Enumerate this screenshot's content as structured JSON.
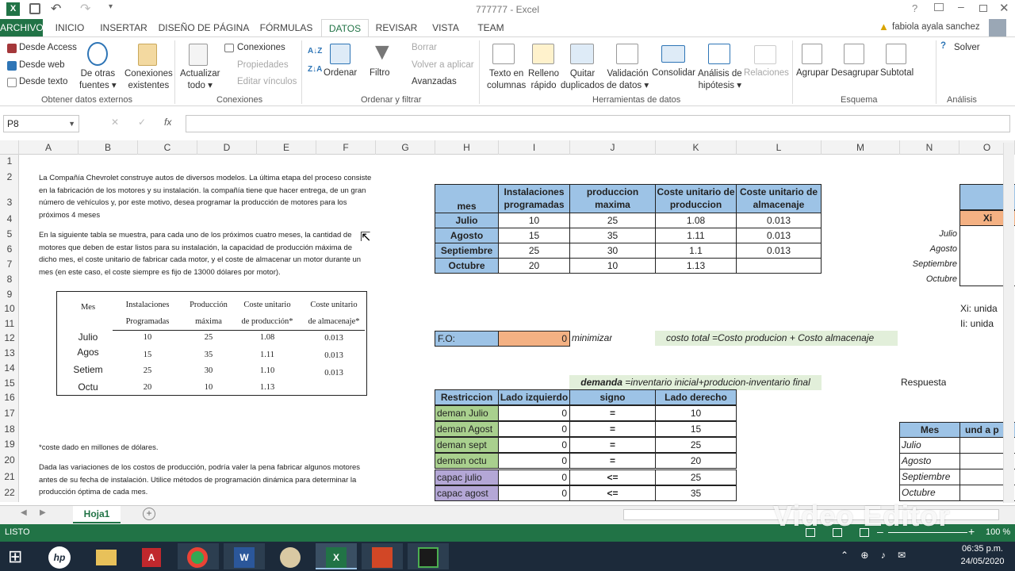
{
  "window": {
    "title": "777777 - Excel",
    "user": "fabiola ayala sanchez"
  },
  "ribbon_tabs": [
    "ARCHIVO",
    "INICIO",
    "INSERTAR",
    "DISEÑO DE PÁGINA",
    "FÓRMULAS",
    "DATOS",
    "REVISAR",
    "VISTA",
    "TEAM"
  ],
  "active_tab": "DATOS",
  "ribbon": {
    "access": "Desde Access",
    "web": "Desde web",
    "text": "Desde texto",
    "other_sources_1": "De otras",
    "other_sources_2": "fuentes",
    "existing_1": "Conexiones",
    "existing_2": "existentes",
    "refresh_1": "Actualizar",
    "refresh_2": "todo",
    "connections": "Conexiones",
    "properties": "Propiedades",
    "edit_links": "Editar vínculos",
    "sort": "Ordenar",
    "filter": "Filtro",
    "clear": "Borrar",
    "reapply": "Volver a aplicar",
    "advanced": "Avanzadas",
    "text_cols_1": "Texto en",
    "text_cols_2": "columnas",
    "flash_1": "Relleno",
    "flash_2": "rápido",
    "remove_dup_1": "Quitar",
    "remove_dup_2": "duplicados",
    "validation_1": "Validación",
    "validation_2": "de datos",
    "consolidate": "Consolidar",
    "whatif_1": "Análisis de",
    "whatif_2": "hipótesis",
    "relations": "Relaciones",
    "group": "Agrupar",
    "ungroup": "Desagrupar",
    "subtotal": "Subtotal",
    "solver": "Solver",
    "groups": {
      "external": "Obtener datos externos",
      "connections": "Conexiones",
      "sortfilter": "Ordenar y filtrar",
      "tools": "Herramientas de datos",
      "outline": "Esquema",
      "analysis": "Análisis"
    }
  },
  "formula_bar": {
    "name_box": "P8",
    "fx": "fx",
    "value": ""
  },
  "columns": [
    "A",
    "B",
    "C",
    "D",
    "E",
    "F",
    "G",
    "H",
    "I",
    "J",
    "K",
    "L",
    "M",
    "N",
    "O"
  ],
  "rows": [
    "1",
    "2",
    "3",
    "4",
    "5",
    "6",
    "7",
    "8",
    "9",
    "10",
    "11",
    "12",
    "13",
    "14",
    "15",
    "16",
    "17",
    "18",
    "19",
    "20",
    "21",
    "22"
  ],
  "problem_text": {
    "p1": [
      "La Compañía Chevrolet construye autos de diversos modelos. La última etapa del proceso consiste",
      "en la fabricación de los motores y su instalación. la compañía tiene que hacer entrega, de un gran",
      "número de vehículos y, por este motivo, desea programar la producción de motores para los",
      "próximos 4 meses"
    ],
    "p2": [
      "En la siguiente tabla se muestra, para cada uno de los próximos cuatro meses, la cantidad de",
      "motores que deben de estar listos para su instalación, la capacidad de producción máxima de",
      "dicho mes, el coste unitario de fabricar cada motor, y el coste de almacenar un motor durante un",
      "mes (en este caso, el coste siempre es fijo de 13000 dólares por motor)."
    ],
    "footnote": "*coste dado en millones de dólares.",
    "p3": [
      "Dada las variaciones de los costos de producción, podría valer la pena fabricar algunos motores",
      "antes de su fecha de instalación. Utilice métodos de programación dinámica para determinar la",
      "producción óptima de cada mes."
    ]
  },
  "image_table": {
    "headers": [
      [
        "Mes",
        ""
      ],
      [
        "Instalaciones",
        "Programadas"
      ],
      [
        "Producción",
        "máxima"
      ],
      [
        "Coste unitario",
        "de producción*"
      ],
      [
        "Coste unitario",
        "de almacenaje*"
      ]
    ],
    "rows": [
      [
        "Julio",
        "10",
        "25",
        "1.08",
        "0.013"
      ],
      [
        "Agos",
        "15",
        "35",
        "1.11",
        "0.013"
      ],
      [
        "Setiem",
        "25",
        "30",
        "1.10",
        "0.013"
      ],
      [
        "Octu",
        "20",
        "10",
        "1.13",
        ""
      ]
    ]
  },
  "data_table": {
    "headers": [
      "mes",
      "Instalaciones programadas",
      "produccion maxima",
      "Coste unitario de produccion",
      "Coste unitario de almacenaje"
    ],
    "rows": [
      [
        "Julio",
        "10",
        "25",
        "1.08",
        "0.013"
      ],
      [
        "Agosto",
        "15",
        "35",
        "1.11",
        "0.013"
      ],
      [
        "Septiembre",
        "25",
        "30",
        "1.1",
        "0.013"
      ],
      [
        "Octubre",
        "20",
        "10",
        "1.13",
        ""
      ]
    ]
  },
  "right_side": {
    "xi_header": "Xi",
    "months": [
      "Julio",
      "Agosto",
      "Septiembre",
      "Octubre"
    ],
    "xi_note": "Xi: unida",
    "ii_note": "Ii: unida",
    "respuesta": "Respuesta",
    "mes_header": "Mes",
    "und_header": "und a p",
    "answer_months": [
      "Julio",
      "Agosto",
      "Septiembre",
      "Octubre"
    ]
  },
  "fo": {
    "label": "F.O:",
    "value": "0",
    "goal": "minimizar",
    "note": "costo total =Costo producion + Costo almacenaje"
  },
  "demand_note": {
    "bold": "demanda",
    "rest": " =inventario inicial+producion-inventario final"
  },
  "constraints": {
    "headers": [
      "Restriccion",
      "Lado izquierdo",
      "signo",
      "Lado derecho"
    ],
    "rows": [
      [
        "deman Julio",
        "0",
        "=",
        "10"
      ],
      [
        "deman Agost",
        "0",
        "=",
        "15"
      ],
      [
        "deman sept",
        "0",
        "=",
        "25"
      ],
      [
        "deman octu",
        "0",
        "=",
        "20"
      ],
      [
        "capac julio",
        "0",
        "<=",
        "25"
      ],
      [
        "capac agost",
        "0",
        "<=",
        "35"
      ]
    ]
  },
  "sheet_tab": "Hoja1",
  "status": {
    "ready": "LISTO",
    "zoom": "100 %"
  },
  "taskbar": {
    "time": "06:35 p.m.",
    "date": "24/05/2020"
  },
  "watermark": "Video Editor"
}
